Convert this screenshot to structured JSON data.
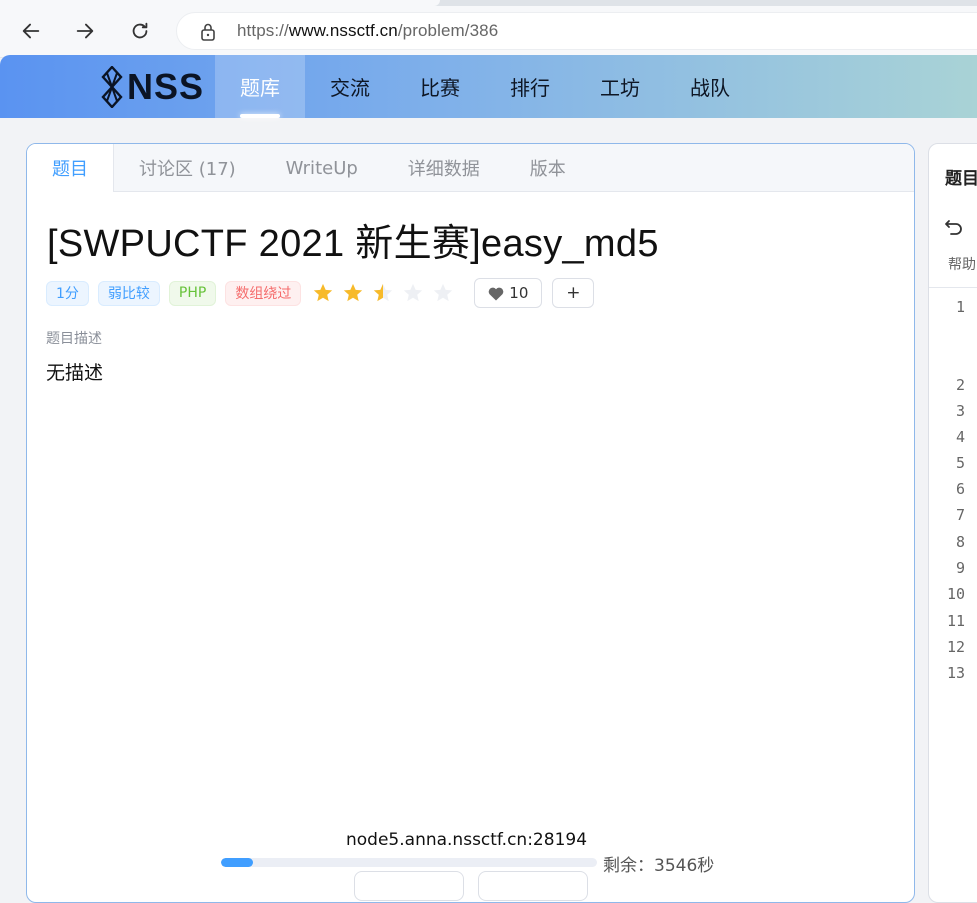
{
  "browser": {
    "url_prefix": "https://",
    "url_host": "www.nssctf.cn",
    "url_path": "/problem/386"
  },
  "site": {
    "logo_text": "NSS",
    "nav": [
      {
        "label": "题库",
        "active": true
      },
      {
        "label": "交流",
        "active": false
      },
      {
        "label": "比赛",
        "active": false
      },
      {
        "label": "排行",
        "active": false
      },
      {
        "label": "工坊",
        "active": false
      },
      {
        "label": "战队",
        "active": false
      }
    ]
  },
  "problem": {
    "tabs": [
      "题目",
      "讨论区 (17)",
      "WriteUp",
      "详细数据",
      "版本"
    ],
    "title": "[SWPUCTF 2021 新生赛]easy_md5",
    "tags": [
      {
        "label": "1分",
        "style": "blue"
      },
      {
        "label": "弱比较",
        "style": "blue"
      },
      {
        "label": "PHP",
        "style": "green"
      },
      {
        "label": "数组绕过",
        "style": "red"
      }
    ],
    "rating": 2.5,
    "rating_max": 5,
    "likes": "10",
    "plus_label": "+",
    "desc_label": "题目描述",
    "desc_text": "无描述"
  },
  "instance": {
    "host": "node5.anna.nssctf.cn:28194",
    "remaining": "剩余：3546秒",
    "progress": 0.085
  },
  "side": {
    "title": "题目",
    "help": "帮助",
    "line_numbers": [
      "1",
      "2",
      "3",
      "4",
      "5",
      "6",
      "7",
      "8",
      "9",
      "10",
      "11",
      "12",
      "13"
    ]
  },
  "colors": {
    "accent": "#409eff",
    "star": "#f7ba2a",
    "star_empty": "#eef0f4"
  }
}
